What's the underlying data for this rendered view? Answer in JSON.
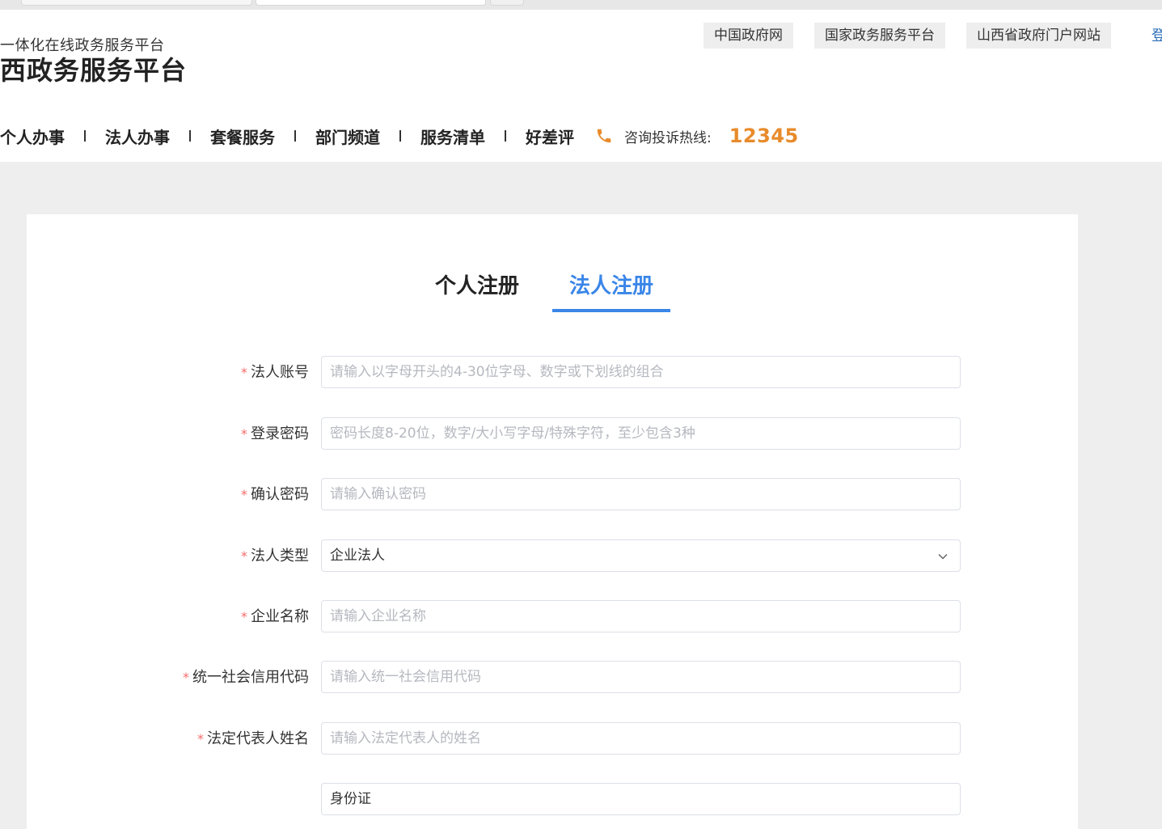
{
  "header": {
    "brand_subtitle": "一体化在线政务服务平台",
    "brand_title": "西政务服务平台",
    "top_links": [
      "中国政府网",
      "国家政务服务平台",
      "山西省政府门户网站"
    ],
    "login_partial": "登"
  },
  "nav": {
    "items": [
      "个人办事",
      "法人办事",
      "套餐服务",
      "部门频道",
      "服务清单",
      "好差评"
    ],
    "hotline_label": "咨询投诉热线:",
    "hotline_number": "12345"
  },
  "tabs": {
    "personal": "个人注册",
    "legal": "法人注册",
    "active": "法人注册"
  },
  "form": {
    "fields": [
      {
        "label": "法人账号",
        "placeholder": "请输入以字母开头的4-30位字母、数字或下划线的组合",
        "required": true
      },
      {
        "label": "登录密码",
        "placeholder": "密码长度8-20位，数字/大小写字母/特殊字符，至少包含3种",
        "required": true
      },
      {
        "label": "确认密码",
        "placeholder": "请输入确认密码",
        "required": true
      },
      {
        "label": "法人类型",
        "value": "企业法人",
        "required": true
      },
      {
        "label": "企业名称",
        "placeholder": "请输入企业名称",
        "required": true
      },
      {
        "label": "统一社会信用代码",
        "placeholder": "请输入统一社会信用代码",
        "required": true
      },
      {
        "label": "法定代表人姓名",
        "placeholder": "请输入法定代表人的姓名",
        "required": true
      }
    ],
    "required_mark": "*",
    "partial_select_value": "身份证"
  },
  "colors": {
    "accent": "#3a86e8",
    "hotline": "#e88b2b",
    "required": "#f56c6c"
  },
  "icons": {
    "phone": "phone-icon",
    "select_arrow": "chevron-down-icon"
  }
}
